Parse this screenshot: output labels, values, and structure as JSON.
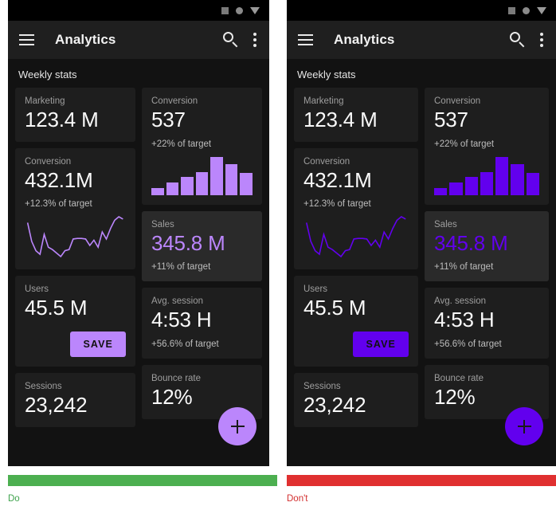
{
  "panels": [
    {
      "verdict": "Do",
      "verdict_color": "#3fa34d",
      "band_color": "#4caf50",
      "accent": "#bb86fc",
      "line_color": "#bb86fc"
    },
    {
      "verdict": "Don't",
      "verdict_color": "#d32f2f",
      "band_color": "#e03030",
      "accent": "#6200ee",
      "line_color": "#6200ee"
    }
  ],
  "statusbar": {
    "icons": [
      "square-icon",
      "circle-icon",
      "triangle-down-icon"
    ]
  },
  "appbar": {
    "menu_icon": "hamburger-menu-icon",
    "title": "Analytics",
    "search_icon": "search-icon",
    "overflow_icon": "more-vert-icon"
  },
  "content": {
    "section_title": "Weekly stats",
    "cards": {
      "marketing": {
        "label": "Marketing",
        "value": "123.4 M"
      },
      "conversion_b": {
        "label": "Conversion",
        "value": "537",
        "sub": "+22% of target"
      },
      "conversion_l": {
        "label": "Conversion",
        "value": "432.1M",
        "sub": "+12.3% of target"
      },
      "sales": {
        "label": "Sales",
        "value": "345.8 M",
        "sub": "+11% of target"
      },
      "users": {
        "label": "Users",
        "value": "45.5 M",
        "save_label": "SAVE"
      },
      "avg_session": {
        "label": "Avg. session",
        "value": "4:53 H",
        "sub": "+56.6% of target"
      },
      "sessions": {
        "label": "Sessions",
        "value": "23,242"
      },
      "bounce": {
        "label": "Bounce rate",
        "value": "12%"
      }
    },
    "fab_icon": "add-plus-icon"
  },
  "chart_data": [
    {
      "type": "bar",
      "title": "Conversion",
      "categories": [
        "1",
        "2",
        "3",
        "4",
        "5",
        "6",
        "7"
      ],
      "values": [
        18,
        33,
        48,
        60,
        100,
        80,
        58
      ],
      "xlabel": "",
      "ylabel": "",
      "ylim": [
        0,
        100
      ],
      "grid": false,
      "legend": false
    },
    {
      "type": "line",
      "title": "Conversion",
      "x": [
        0,
        1,
        2,
        3,
        4,
        5,
        6,
        7,
        8,
        9,
        10,
        11,
        12,
        13,
        14,
        15,
        16,
        17,
        18,
        19,
        20,
        21,
        22,
        23
      ],
      "values": [
        72,
        40,
        24,
        18,
        52,
        30,
        26,
        20,
        14,
        24,
        26,
        44,
        45,
        45,
        44,
        33,
        42,
        30,
        56,
        44,
        62,
        76,
        82,
        78
      ],
      "xlabel": "",
      "ylabel": "",
      "ylim": [
        0,
        100
      ],
      "grid": false,
      "legend": false
    }
  ]
}
